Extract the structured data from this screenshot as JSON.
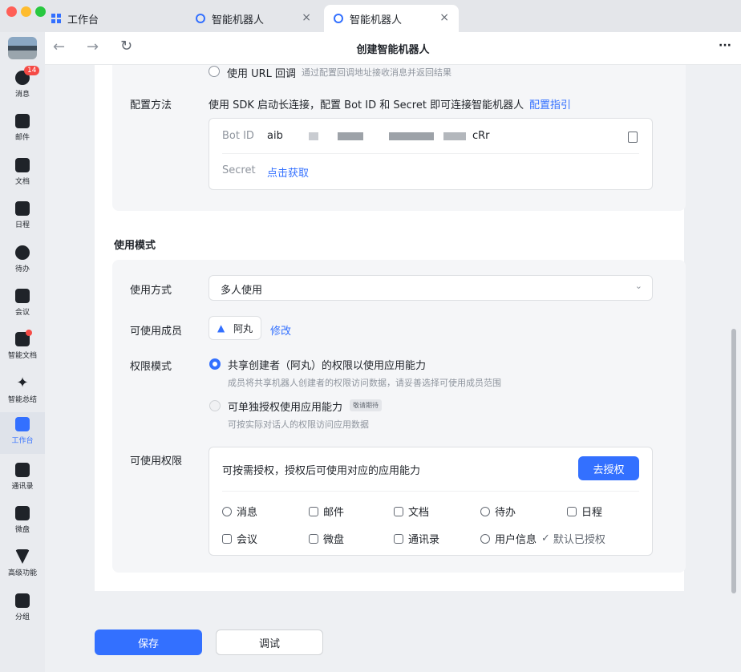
{
  "tabs": [
    {
      "label": "工作台"
    },
    {
      "label": "智能机器人"
    },
    {
      "label": "智能机器人"
    }
  ],
  "sidebar": {
    "items": [
      {
        "label": "消息",
        "badge": "14"
      },
      {
        "label": "邮件"
      },
      {
        "label": "文档"
      },
      {
        "label": "日程"
      },
      {
        "label": "待办"
      },
      {
        "label": "会议"
      },
      {
        "label": "智能文档"
      },
      {
        "label": "智能总结"
      },
      {
        "label": "工作台"
      },
      {
        "label": "通讯录"
      },
      {
        "label": "微盘"
      },
      {
        "label": "高级功能"
      },
      {
        "label": "分组"
      }
    ]
  },
  "nav": {
    "title": "创建智能机器人",
    "more": "···"
  },
  "config": {
    "url_option": "使用 URL 回调",
    "url_desc": "通过配置回调地址接收消息并返回结果",
    "method_label": "配置方法",
    "method_text": "使用 SDK 启动长连接，配置 Bot ID 和 Secret 即可连接智能机器人",
    "guide_link": "配置指引",
    "bot_id_label": "Bot ID",
    "bot_id_prefix": "aib",
    "bot_id_suffix": "cRr",
    "secret_label": "Secret",
    "secret_action": "点击获取"
  },
  "mode": {
    "section_title": "使用模式",
    "usage_label": "使用方式",
    "usage_value": "多人使用",
    "members_label": "可使用成员",
    "member_name": "阿丸",
    "edit_link": "修改",
    "perm_mode_label": "权限模式",
    "opt1": "共享创建者（阿丸）的权限以使用应用能力",
    "opt1_desc": "成员将共享机器人创建者的权限访问数据，请妥善选择可使用成员范围",
    "opt2": "可单独授权使用应用能力",
    "opt2_tag": "敬请期待",
    "opt2_desc": "可按实际对话人的权限访问应用数据",
    "perms_label": "可使用权限",
    "perms_desc": "可按需授权，授权后可使用对应的应用能力",
    "authorize_btn": "去授权",
    "perms": [
      "消息",
      "邮件",
      "文档",
      "待办",
      "日程",
      "会议",
      "微盘",
      "通讯录",
      "用户信息"
    ],
    "default_auth": "默认已授权"
  },
  "footer": {
    "save": "保存",
    "debug": "调试"
  },
  "colors": {
    "accent": "#3370ff",
    "badge": "#f54a45"
  }
}
